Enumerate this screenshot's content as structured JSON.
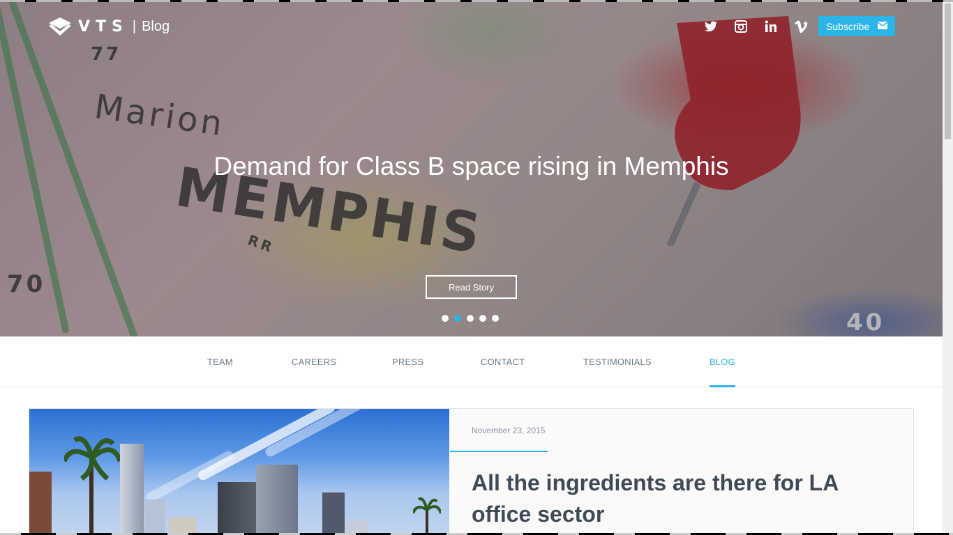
{
  "header": {
    "brand": "VTS",
    "separator": "|",
    "section": "Blog",
    "social_icons": [
      "twitter-icon",
      "instagram-icon",
      "linkedin-icon",
      "vimeo-icon"
    ],
    "subscribe_label": "Subscribe",
    "subscribe_icon": "envelope-icon"
  },
  "hero": {
    "title": "Demand for Class B space rising in Memphis",
    "cta_label": "Read Story",
    "slides_count": 5,
    "active_slide": 2,
    "map_labels": [
      "MEMPHIS",
      "Marion",
      "70",
      "77",
      "40",
      "RR"
    ]
  },
  "tabs": {
    "items": [
      {
        "label": "TEAM",
        "active": false
      },
      {
        "label": "CAREERS",
        "active": false
      },
      {
        "label": "PRESS",
        "active": false
      },
      {
        "label": "CONTACT",
        "active": false
      },
      {
        "label": "TESTIMONIALS",
        "active": false
      },
      {
        "label": "BLOG",
        "active": true
      }
    ]
  },
  "post": {
    "date": "November 23, 2015",
    "title": "All the ingredients are there for LA office sector"
  },
  "colors": {
    "accent": "#2bb5e6",
    "tab_text": "#6b7b8e",
    "title_text": "#3f4a59",
    "date_text": "#8b96a3"
  }
}
